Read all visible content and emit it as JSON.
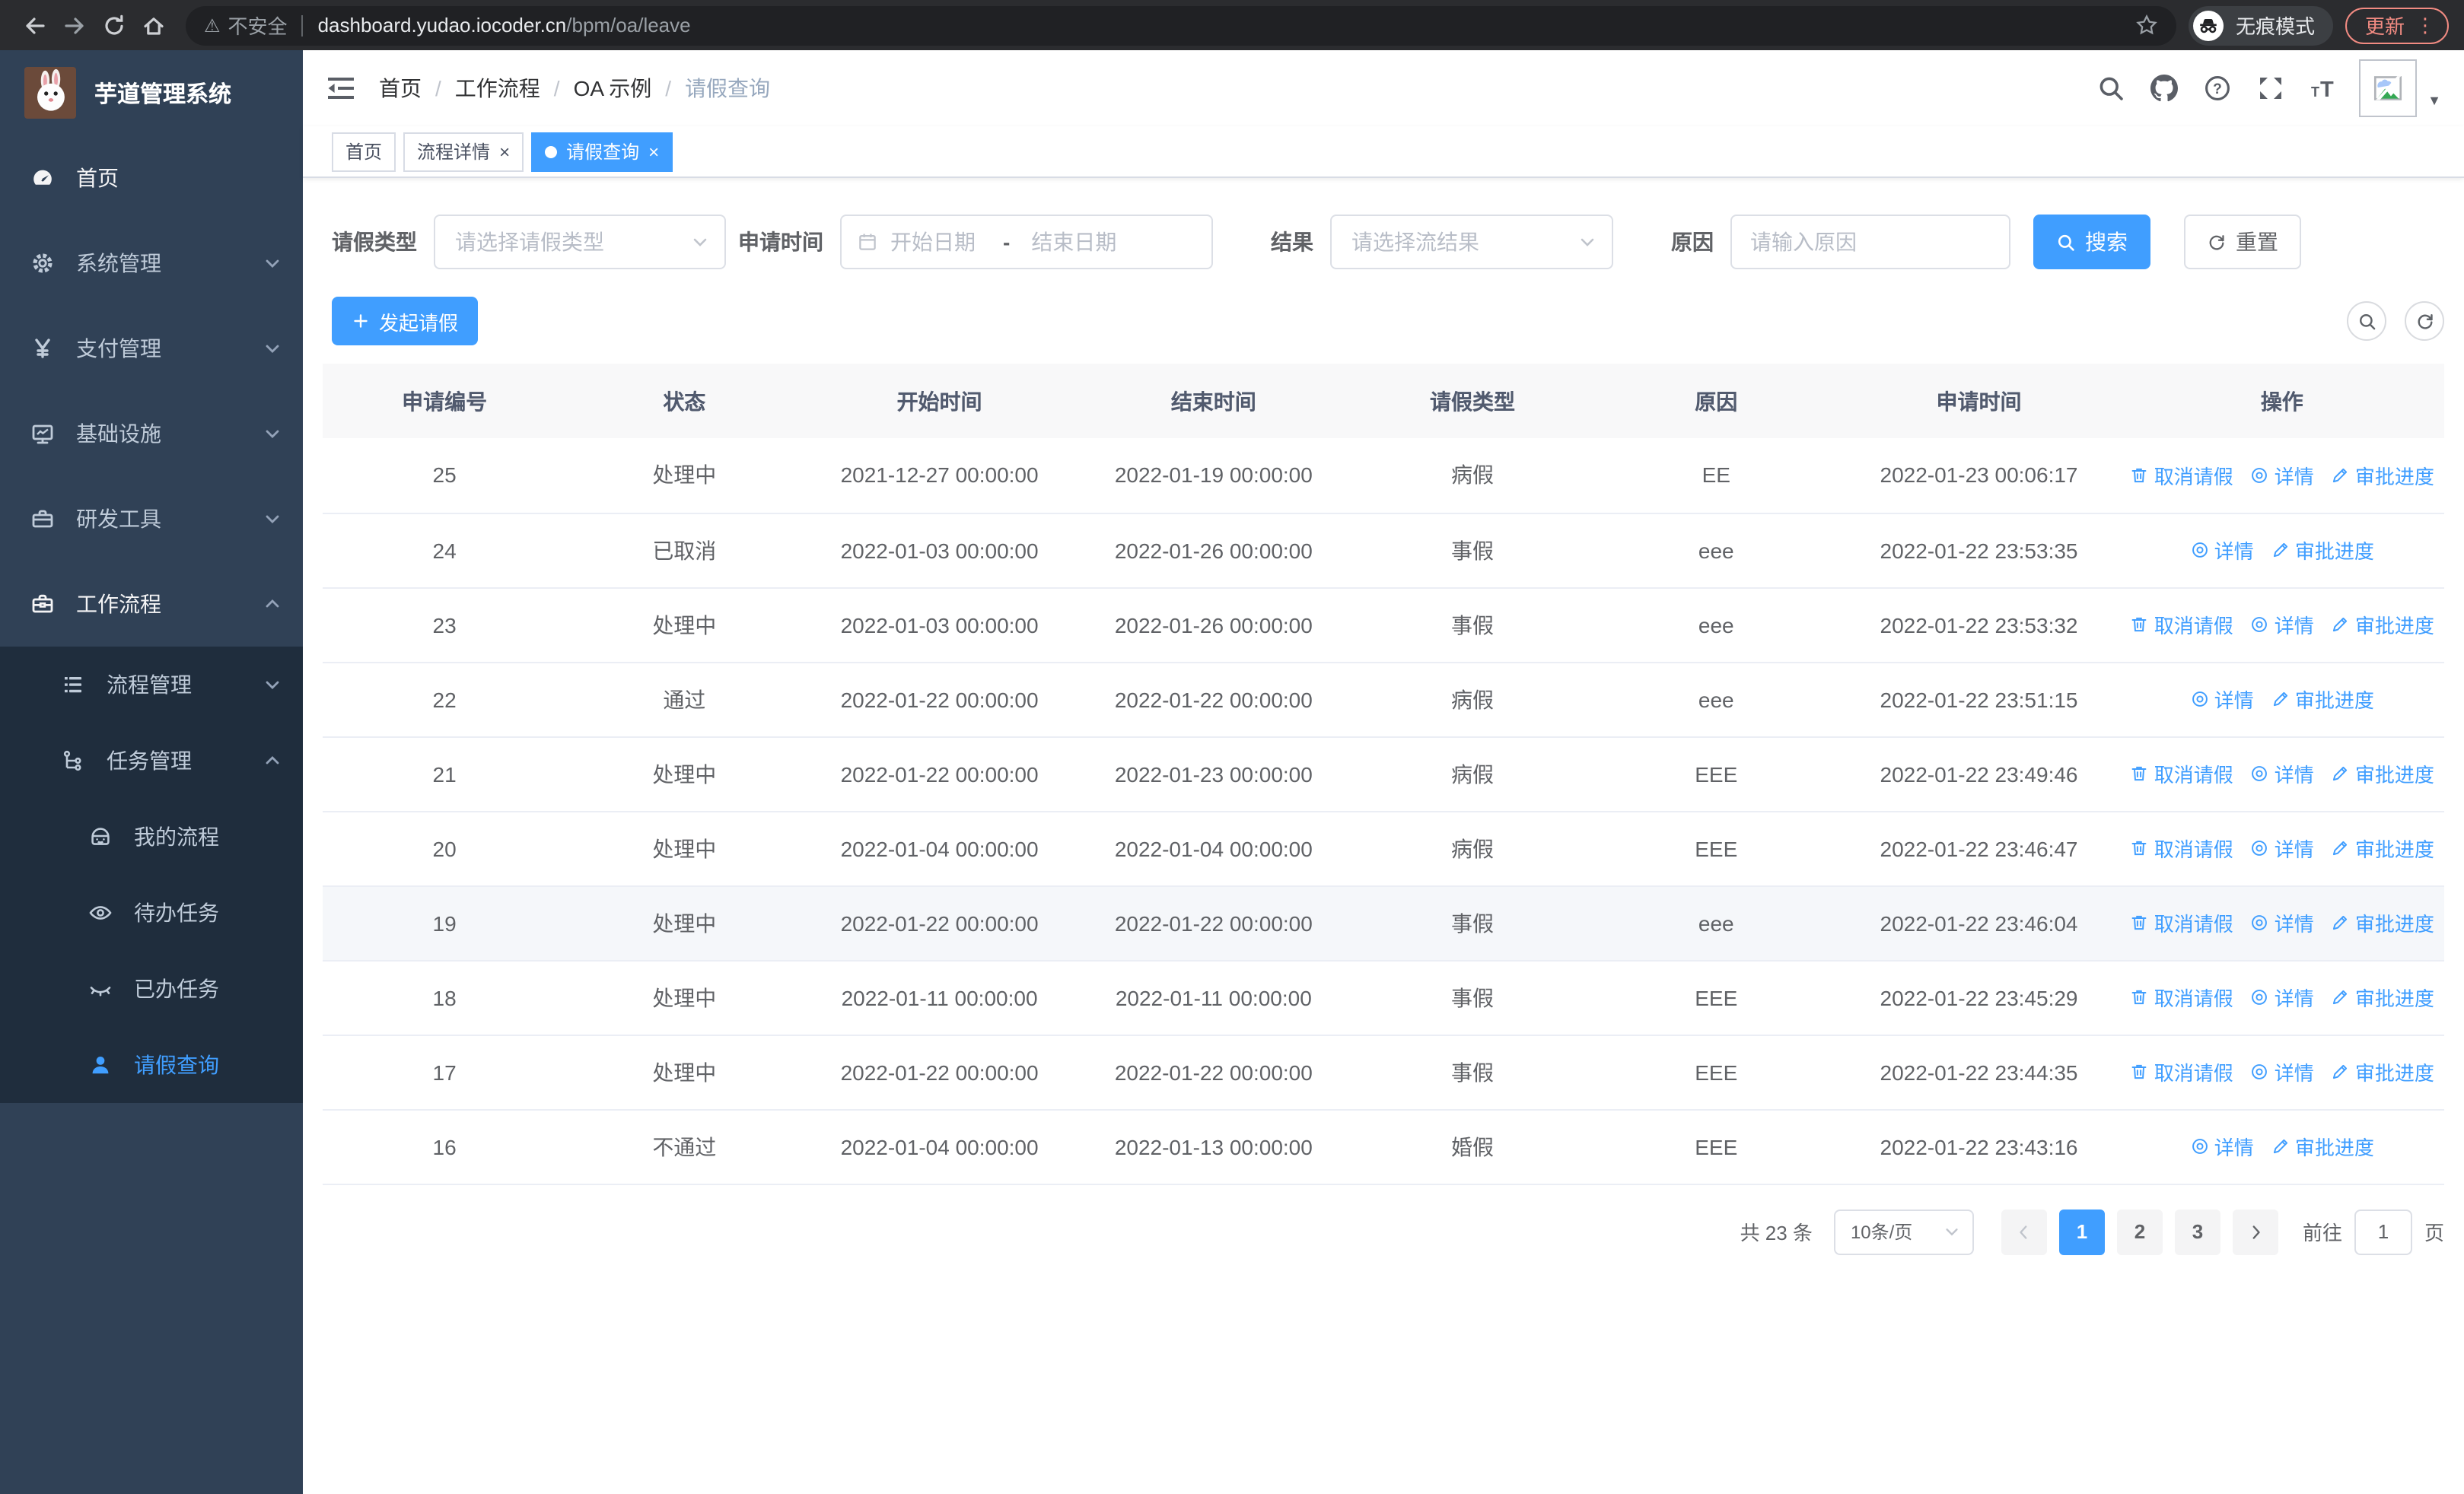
{
  "colors": {
    "accent": "#409eff",
    "sidebar_bg": "#304156",
    "submenu_bg": "#1f2d3d",
    "update_red": "#f28b82"
  },
  "browser": {
    "security": "不安全",
    "url_host": "dashboard.yudao.iocoder.cn",
    "url_path": "/bpm/oa/leave",
    "incognito_label": "无痕模式",
    "update_label": "更新"
  },
  "sidebar": {
    "title": "芋道管理系统",
    "menu": [
      {
        "name": "home",
        "label": "首页",
        "icon": "dashboard-icon",
        "bright": true
      },
      {
        "name": "system",
        "label": "系统管理",
        "icon": "gear-icon",
        "chevron": "down"
      },
      {
        "name": "payment",
        "label": "支付管理",
        "icon": "yen-icon",
        "chevron": "down"
      },
      {
        "name": "infrastructure",
        "label": "基础设施",
        "icon": "monitor-icon",
        "chevron": "down"
      },
      {
        "name": "dev-tools",
        "label": "研发工具",
        "icon": "toolbox-icon",
        "chevron": "down"
      },
      {
        "name": "workflow",
        "label": "工作流程",
        "icon": "briefcase-icon",
        "chevron": "up",
        "bright": true
      }
    ],
    "submenu": [
      {
        "name": "process-mgmt",
        "label": "流程管理",
        "icon": "list-icon",
        "chevron": "down",
        "level": 1
      },
      {
        "name": "task-mgmt",
        "label": "任务管理",
        "icon": "tree-icon",
        "chevron": "up",
        "level": 1
      },
      {
        "name": "my-process",
        "label": "我的流程",
        "icon": "robot-icon",
        "level": 2
      },
      {
        "name": "todo-tasks",
        "label": "待办任务",
        "icon": "eye-open-icon",
        "level": 2
      },
      {
        "name": "done-tasks",
        "label": "已办任务",
        "icon": "eye-closed-icon",
        "level": 2
      },
      {
        "name": "leave-query",
        "label": "请假查询",
        "icon": "user-icon",
        "level": 2,
        "active": true
      }
    ]
  },
  "navbar": {
    "breadcrumb": [
      "首页",
      "工作流程",
      "OA 示例",
      "请假查询"
    ]
  },
  "tags": [
    {
      "name": "home",
      "label": "首页",
      "closable": false,
      "active": false
    },
    {
      "name": "process-detail",
      "label": "流程详情",
      "closable": true,
      "active": false
    },
    {
      "name": "leave-query",
      "label": "请假查询",
      "closable": true,
      "active": true
    }
  ],
  "filters": {
    "leave_type": {
      "label": "请假类型",
      "placeholder": "请选择请假类型"
    },
    "apply_time": {
      "label": "申请时间",
      "start": "开始日期",
      "sep": "-",
      "end": "结束日期"
    },
    "result": {
      "label": "结果",
      "placeholder": "请选择流结果"
    },
    "reason": {
      "label": "原因",
      "placeholder": "请输入原因"
    },
    "search_label": "搜索",
    "reset_label": "重置"
  },
  "toolbar": {
    "create_label": "发起请假"
  },
  "table": {
    "headers": [
      "申请编号",
      "状态",
      "开始时间",
      "结束时间",
      "请假类型",
      "原因",
      "申请时间",
      "操作"
    ],
    "action_labels": {
      "cancel": "取消请假",
      "detail": "详情",
      "progress": "审批进度"
    },
    "rows": [
      {
        "id": "25",
        "status": "处理中",
        "start": "2021-12-27 00:00:00",
        "end": "2022-01-19 00:00:00",
        "type": "病假",
        "reason": "EE",
        "applied": "2022-01-23 00:06:17",
        "actions": [
          "cancel",
          "detail",
          "progress"
        ]
      },
      {
        "id": "24",
        "status": "已取消",
        "start": "2022-01-03 00:00:00",
        "end": "2022-01-26 00:00:00",
        "type": "事假",
        "reason": "eee",
        "applied": "2022-01-22 23:53:35",
        "actions": [
          "detail",
          "progress"
        ]
      },
      {
        "id": "23",
        "status": "处理中",
        "start": "2022-01-03 00:00:00",
        "end": "2022-01-26 00:00:00",
        "type": "事假",
        "reason": "eee",
        "applied": "2022-01-22 23:53:32",
        "actions": [
          "cancel",
          "detail",
          "progress"
        ]
      },
      {
        "id": "22",
        "status": "通过",
        "start": "2022-01-22 00:00:00",
        "end": "2022-01-22 00:00:00",
        "type": "病假",
        "reason": "eee",
        "applied": "2022-01-22 23:51:15",
        "actions": [
          "detail",
          "progress"
        ]
      },
      {
        "id": "21",
        "status": "处理中",
        "start": "2022-01-22 00:00:00",
        "end": "2022-01-23 00:00:00",
        "type": "病假",
        "reason": "EEE",
        "applied": "2022-01-22 23:49:46",
        "actions": [
          "cancel",
          "detail",
          "progress"
        ]
      },
      {
        "id": "20",
        "status": "处理中",
        "start": "2022-01-04 00:00:00",
        "end": "2022-01-04 00:00:00",
        "type": "病假",
        "reason": "EEE",
        "applied": "2022-01-22 23:46:47",
        "actions": [
          "cancel",
          "detail",
          "progress"
        ]
      },
      {
        "id": "19",
        "status": "处理中",
        "start": "2022-01-22 00:00:00",
        "end": "2022-01-22 00:00:00",
        "type": "事假",
        "reason": "eee",
        "applied": "2022-01-22 23:46:04",
        "actions": [
          "cancel",
          "detail",
          "progress"
        ],
        "highlight": true
      },
      {
        "id": "18",
        "status": "处理中",
        "start": "2022-01-11 00:00:00",
        "end": "2022-01-11 00:00:00",
        "type": "事假",
        "reason": "EEE",
        "applied": "2022-01-22 23:45:29",
        "actions": [
          "cancel",
          "detail",
          "progress"
        ]
      },
      {
        "id": "17",
        "status": "处理中",
        "start": "2022-01-22 00:00:00",
        "end": "2022-01-22 00:00:00",
        "type": "事假",
        "reason": "EEE",
        "applied": "2022-01-22 23:44:35",
        "actions": [
          "cancel",
          "detail",
          "progress"
        ]
      },
      {
        "id": "16",
        "status": "不通过",
        "start": "2022-01-04 00:00:00",
        "end": "2022-01-13 00:00:00",
        "type": "婚假",
        "reason": "EEE",
        "applied": "2022-01-22 23:43:16",
        "actions": [
          "detail",
          "progress"
        ]
      }
    ]
  },
  "pagination": {
    "total": "共 23 条",
    "page_size": "10条/页",
    "pages": [
      "1",
      "2",
      "3"
    ],
    "active": "1",
    "goto_prefix": "前往",
    "goto_value": "1",
    "goto_suffix": "页"
  }
}
